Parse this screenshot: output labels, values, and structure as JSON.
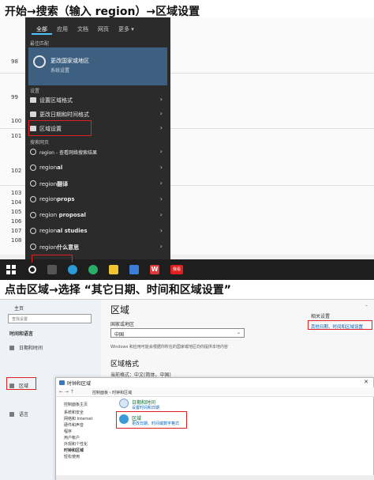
{
  "heading_1": "开始→搜索（输入 region）→区域设置",
  "heading_2": "点击区域→选择 “其它日期、时间和区域设置”",
  "sheet": {
    "rows": [
      "98",
      "99",
      "100",
      "101",
      "102",
      "103",
      "104",
      "105",
      "106",
      "107",
      "108"
    ]
  },
  "start_menu": {
    "tabs": [
      "全部",
      "应用",
      "文档",
      "网页",
      "更多 ▾"
    ],
    "best_match_title": "最佳匹配",
    "best_match": {
      "title": "更改国家或地区",
      "subtitle": "系统设置"
    },
    "settings_title": "设置",
    "settings_items": [
      "设置区域格式",
      "更改日期和时间格式",
      "区域设置"
    ],
    "web_title": "搜索网页",
    "web_items": [
      {
        "label": "region",
        "suffix": " - 查看网络搜索结果"
      },
      {
        "label": "region",
        "suffix": "al"
      },
      {
        "label": "region",
        "suffix": "翻译"
      },
      {
        "label": "region",
        "suffix": "props"
      },
      {
        "label": "region",
        "suffix": " proposal"
      },
      {
        "label": "region",
        "suffix": "al studies"
      },
      {
        "label": "region",
        "suffix": "什么意思"
      }
    ]
  },
  "taskbar": {
    "badge_text": "我看"
  },
  "settings_window": {
    "home": "主页",
    "search_placeholder": "查找设置",
    "group": "时间和语言",
    "nav": [
      "日期和时间",
      "区域",
      "语言"
    ],
    "title": "区域",
    "country_label": "国家或地区",
    "country_value": "中国",
    "desc": "Windows 和应用可能会根据你所在的国家或地区向你提供本地内容",
    "format_title": "区域格式",
    "format_label": "当前格式：中文(简体，中国)",
    "related_title": "相关设置",
    "related_link": "其他日期、时间和区域设置"
  },
  "control_panel": {
    "title": "时钟和区域",
    "address": "控制面板 › 时钟和区域",
    "left_links": [
      "控制面板主页",
      "系统和安全",
      "网络和 Internet",
      "硬件和声音",
      "程序",
      "用户帐户",
      "外观和个性化",
      "时钟和区域",
      "轻松使用"
    ],
    "items": [
      {
        "title": "日期和时间",
        "sub": "设置时间和日期"
      },
      {
        "title": "区域",
        "sub": "更改日期、时间或数字格式"
      }
    ]
  },
  "colors": {
    "menu_bg": "#2b2b2b",
    "highlight": "#3d5f80",
    "red_box": "#e02020",
    "link": "#0067c0"
  }
}
